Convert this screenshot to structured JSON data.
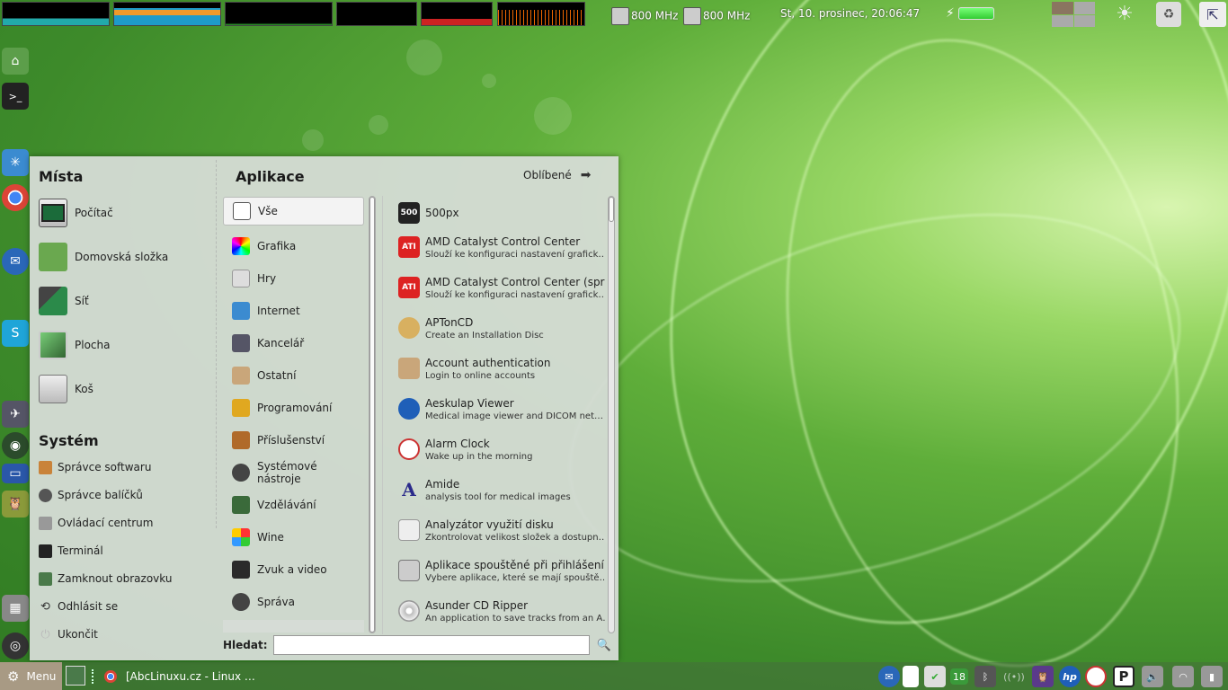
{
  "top_panel": {
    "cpu1_freq": "800 MHz",
    "cpu2_freq": "800 MHz",
    "clock": "St, 10. prosinec, 20:06:47",
    "icons": [
      "cpu-freq-icon",
      "cpu-freq-icon",
      "battery-icon",
      "workspace-switcher-icon",
      "brightness-icon",
      "trash-icon",
      "show-desktop-icon"
    ]
  },
  "dock": {
    "icons": [
      "home-folder-icon",
      "terminal-icon",
      "network-icon",
      "chrome-icon",
      "thunderbird-icon",
      "skype-icon",
      "satellite-icon",
      "globe-icon",
      "router-icon",
      "owl-icon",
      "calculator-icon",
      "camera-icon"
    ]
  },
  "menu": {
    "places_title": "Místa",
    "places": [
      {
        "label": "Počítač",
        "icon": "computer-icon"
      },
      {
        "label": "Domovská složka",
        "icon": "home-folder-icon"
      },
      {
        "label": "Síť",
        "icon": "network-icon"
      },
      {
        "label": "Plocha",
        "icon": "desktop-icon"
      },
      {
        "label": "Koš",
        "icon": "trash-icon"
      }
    ],
    "system_title": "Systém",
    "system": [
      {
        "label": "Správce softwaru",
        "icon": "software-manager-icon"
      },
      {
        "label": "Správce balíčků",
        "icon": "package-manager-icon"
      },
      {
        "label": "Ovládací centrum",
        "icon": "control-center-icon"
      },
      {
        "label": "Terminál",
        "icon": "terminal-icon"
      },
      {
        "label": "Zamknout obrazovku",
        "icon": "lock-screen-icon"
      },
      {
        "label": "Odhlásit se",
        "icon": "logout-icon"
      },
      {
        "label": "Ukončit",
        "icon": "power-icon"
      }
    ],
    "apps_title": "Aplikace",
    "favorites_label": "Oblíbené",
    "categories": [
      {
        "label": "Vše",
        "icon": "all-apps-icon"
      },
      {
        "label": "Grafika",
        "icon": "graphics-icon"
      },
      {
        "label": "Hry",
        "icon": "games-icon"
      },
      {
        "label": "Internet",
        "icon": "internet-icon"
      },
      {
        "label": "Kancelář",
        "icon": "office-icon"
      },
      {
        "label": "Ostatní",
        "icon": "other-icon"
      },
      {
        "label": "Programování",
        "icon": "programming-icon"
      },
      {
        "label": "Příslušenství",
        "icon": "accessories-icon"
      },
      {
        "label": "Systémové nástroje",
        "icon": "system-tools-icon"
      },
      {
        "label": "Vzdělávání",
        "icon": "education-icon"
      },
      {
        "label": "Wine",
        "icon": "wine-icon"
      },
      {
        "label": "Zvuk a video",
        "icon": "sound-video-icon"
      },
      {
        "label": "Správa",
        "icon": "administration-icon"
      }
    ],
    "applications": [
      {
        "name": "500px",
        "desc": "",
        "icon_text": "500"
      },
      {
        "name": "AMD Catalyst Control Center",
        "desc": "Slouží ke konfiguraci nastavení grafick…",
        "icon_text": "ATI"
      },
      {
        "name": "AMD Catalyst Control Center (spr…",
        "desc": "Slouží ke konfiguraci nastavení grafick…",
        "icon_text": "ATI"
      },
      {
        "name": "APTonCD",
        "desc": "Create an Installation Disc",
        "icon_text": ""
      },
      {
        "name": "Account authentication",
        "desc": "Login to online accounts",
        "icon_text": ""
      },
      {
        "name": "Aeskulap Viewer",
        "desc": "Medical image viewer and DICOM net…",
        "icon_text": ""
      },
      {
        "name": "Alarm Clock",
        "desc": "Wake up in the morning",
        "icon_text": ""
      },
      {
        "name": "Amide",
        "desc": "analysis tool for medical images",
        "icon_text": "A"
      },
      {
        "name": "Analyzátor využití disku",
        "desc": "Zkontrolovat velikost složek a dostupn…",
        "icon_text": ""
      },
      {
        "name": "Aplikace spouštěné při přihlášení",
        "desc": "Vybere aplikace, které se mají spouště…",
        "icon_text": ""
      },
      {
        "name": "Asunder CD Ripper",
        "desc": "An application to save tracks from an A…",
        "icon_text": ""
      }
    ],
    "search_label": "Hledat:",
    "search_value": ""
  },
  "bottom_panel": {
    "menu_label": "Menu",
    "task_title": "[AbcLinuxu.cz - Linux …",
    "tray_badge": "18",
    "tray_icons": [
      "thunderbird-icon",
      "file-icon",
      "shield-icon",
      "update-badge-icon",
      "bluetooth-icon",
      "wireless-signal-icon",
      "owl-icon",
      "hp-icon",
      "alarm-clock-icon",
      "p-icon",
      "volume-icon",
      "wifi-icon",
      "battery-icon"
    ]
  }
}
